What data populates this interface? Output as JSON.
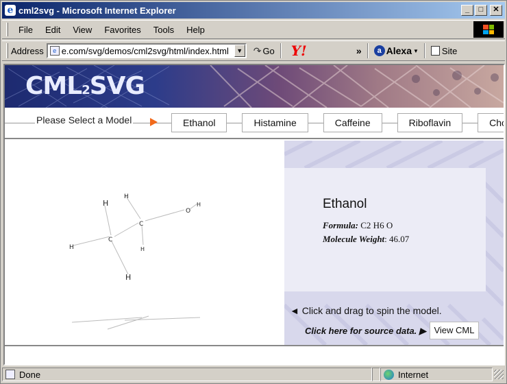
{
  "window": {
    "title": "cml2svg - Microsoft Internet Explorer",
    "icon": "ie-icon",
    "min": "_",
    "max": "□",
    "close": "✕"
  },
  "menu": [
    "File",
    "Edit",
    "View",
    "Favorites",
    "Tools",
    "Help"
  ],
  "address": {
    "label": "Address",
    "url": "e.com/svg/demos/cml2svg/html/index.html",
    "go_label": "Go",
    "yahoo": "Y!",
    "chevron": "»",
    "alexa": "Alexa",
    "site": "Site"
  },
  "banner": {
    "logo_a": "CML",
    "logo_b": "2",
    "logo_c": "SVG"
  },
  "nav": {
    "title": "Please Select a Model",
    "tabs": [
      "Ethanol",
      "Histamine",
      "Caffeine",
      "Riboflavin",
      "Choleste"
    ]
  },
  "molecule": {
    "atoms": [
      "H",
      "H",
      "C",
      "O",
      "H",
      "C",
      "H",
      "H",
      "H"
    ]
  },
  "info": {
    "name": "Ethanol",
    "formula_label": "Formula:",
    "formula_value": "C2 H6 O",
    "weight_label": "Molecule Weight",
    "weight_value": ": 46.07",
    "hint": "◄  Click and drag to spin the model.",
    "source": "Click here for source data. ▶",
    "view_cml": "View CML"
  },
  "status": {
    "left": "Done",
    "zone": "Internet"
  },
  "colors": {
    "accent_arrow": "#f26a1b",
    "title_bar": "#0a246a"
  }
}
